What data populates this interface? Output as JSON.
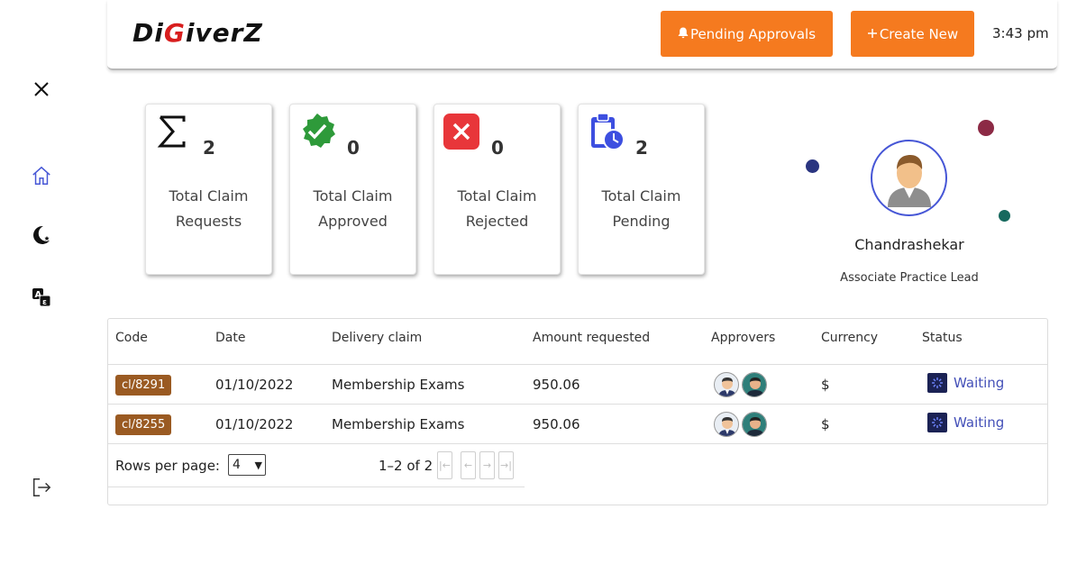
{
  "header": {
    "logo_prefix": "Di",
    "logo_mid": "G",
    "logo_suffix": "iverZ",
    "pending_label": "Pending Approvals",
    "create_label": "Create New",
    "time": "3:43 pm",
    "accent": "#f57a1f"
  },
  "sidebar": {
    "items": [
      {
        "icon": "close-icon"
      },
      {
        "icon": "home-icon"
      },
      {
        "icon": "dark-mode-icon"
      },
      {
        "icon": "translate-icon"
      },
      {
        "icon": "logout-icon"
      }
    ]
  },
  "stats": [
    {
      "icon": "sigma-icon",
      "count": "2",
      "label_line1": "Total Claim",
      "label_line2": "Requests"
    },
    {
      "icon": "approved-check-icon",
      "count": "0",
      "label_line1": "Total Claim",
      "label_line2": "Approved",
      "color": "#2e9a3a"
    },
    {
      "icon": "rejected-x-icon",
      "count": "0",
      "label_line1": "Total Claim",
      "label_line2": "Rejected",
      "color": "#e8363a"
    },
    {
      "icon": "pending-clipboard-icon",
      "count": "2",
      "label_line1": "Total Claim",
      "label_line2": "Pending",
      "color": "#3d4fe0"
    }
  ],
  "profile": {
    "name": "Chandrashekar",
    "role": "Associate Practice Lead"
  },
  "table": {
    "columns": [
      "Code",
      "Date",
      "Delivery claim",
      "Amount requested",
      "Approvers",
      "Currency",
      "Status"
    ],
    "rows": [
      {
        "code": "cl/8291",
        "date": "01/10/2022",
        "claim": "Membership Exams",
        "amount": "950.06",
        "currency": "$",
        "status": "Waiting"
      },
      {
        "code": "cl/8255",
        "date": "01/10/2022",
        "claim": "Membership Exams",
        "amount": "950.06",
        "currency": "$",
        "status": "Waiting"
      }
    ],
    "code_badge_color": "#9a5a22",
    "status_color": "#4450b8"
  },
  "pagination": {
    "rows_per_page_label": "Rows per page:",
    "rows_per_page_value": "4",
    "range": "1–2 of 2"
  }
}
